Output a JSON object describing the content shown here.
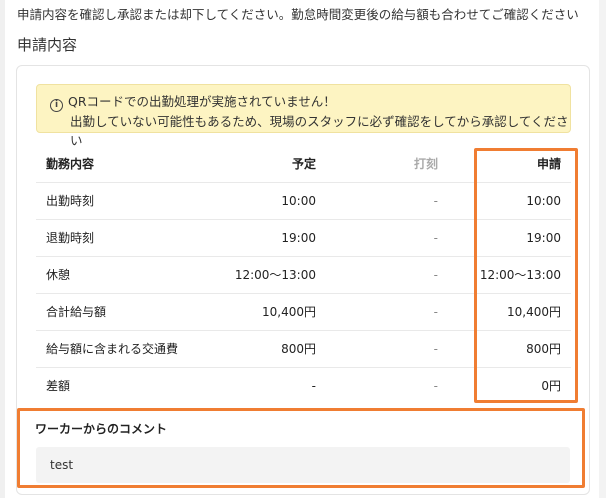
{
  "instruction": "申請内容を確認し承認または却下してください。勤怠時間変更後の給与額も合わせてご確認ください",
  "section_title": "申請内容",
  "alert": {
    "icon": "info-icon",
    "line1": "QRコードでの出勤処理が実施されていません！",
    "line2": "出勤していない可能性もあるため、現場のスタッフに必ず確認をしてから承認してください"
  },
  "table": {
    "headers": [
      "勤務内容",
      "予定",
      "打刻",
      "申請"
    ],
    "rows": [
      [
        "出勤時刻",
        "10:00",
        "-",
        "10:00"
      ],
      [
        "退勤時刻",
        "19:00",
        "-",
        "19:00"
      ],
      [
        "休憩",
        "12:00〜13:00",
        "-",
        "12:00〜13:00"
      ],
      [
        "合計給与額",
        "10,400円",
        "-",
        "10,400円"
      ],
      [
        "給与額に含まれる交通費",
        "800円",
        "-",
        "800円"
      ],
      [
        "差額",
        "-",
        "-",
        "0円"
      ]
    ]
  },
  "comment": {
    "label": "ワーカーからのコメント",
    "text": "test"
  },
  "colors": {
    "highlight": "#f07d32",
    "alert_bg": "#fdf4c2"
  }
}
